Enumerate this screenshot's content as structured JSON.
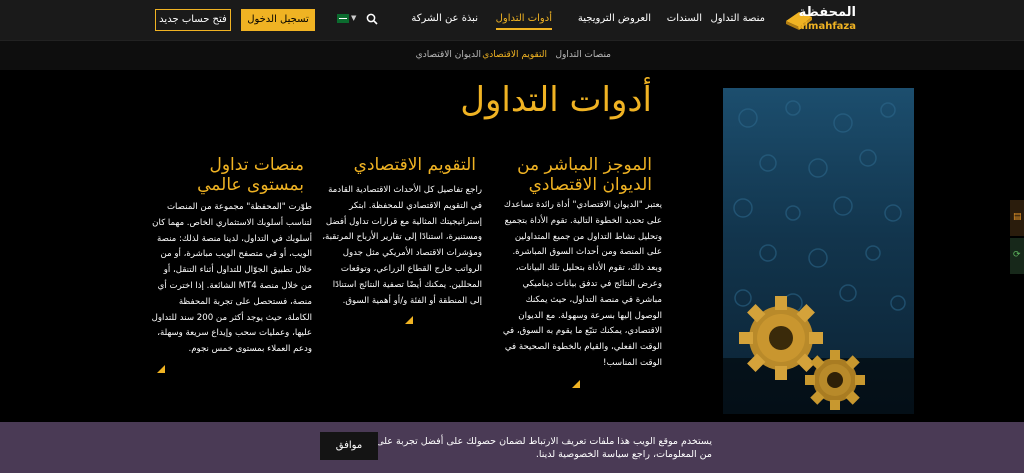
{
  "header": {
    "logo_ar": "المحفظة",
    "logo_en": "almahfaza",
    "nav": [
      {
        "label": "منصة التداول",
        "active": false
      },
      {
        "label": "السندات",
        "active": false
      },
      {
        "label": "العروض الترويجية",
        "active": false
      },
      {
        "label": "أدوات التداول",
        "active": true
      },
      {
        "label": "نبذة عن الشركة",
        "active": false
      }
    ],
    "language_flag": "saudi-flag-icon",
    "login_label": "تسجيل الدخول",
    "open_account_label": "فتح حساب جديد"
  },
  "subnav": [
    {
      "label": "منصات التداول",
      "active": false
    },
    {
      "label": "التقويم الاقتصادي",
      "active": true
    },
    {
      "label": "الديوان الاقتصادي",
      "active": false
    }
  ],
  "main": {
    "title": "أدوات التداول",
    "columns": [
      {
        "title": "الموجز المباشر من الديوان الاقتصادي",
        "text": "يعتبر \"الديوان الاقتصادي\" أداة رائدة تساعدك على تحديد الخطوة التالية. تقوم الأداة بتجميع وتحليل نشاط التداول من جميع المتداولين على المنصة ومن أحداث السوق المباشرة. وبعد ذلك، تقوم الأداة بتحليل تلك البيانات، وعرض النتائج في تدفق بيانات ديناميكي مباشرة في منصة التداول، حيث يمكنك الوصول إليها بسرعة وسهولة. مع الديوان الاقتصادي، يمكنك تتبّع ما يقوم به السوق، في الوقت الفعلي، والقيام بالخطوة الصحيحة في الوقت المناسب!"
      },
      {
        "title": "التقويم الاقتصادي",
        "text": "راجع تفاصيل كل الأحداث الاقتصادية القادمة في التقويم الاقتصادي للمحفظة. ابتكر إستراتيجيتك المثالية مع قرارات تداول أفضل ومستنيرة، استنادًا إلى تقارير الأرباح المرتقبة، ومؤشرات الاقتصاد الأمريكي مثل جدول الرواتب خارج القطاع الزراعي، وتوقعات المحللين. يمكنك أيضًا تصفية النتائج استنادًا إلى المنطقة أو الفئة و/أو أهمية السوق."
      },
      {
        "title": "منصات تداول بمستوى عالمي",
        "text": "طوّرت \"المحفظة\" مجموعة من المنصات لتناسب أسلوبك الاستثماري الخاص. مهما كان أسلوبك في التداول، لدينا منصة لذلك: منصة الويب، أو في متصفح الويب مباشرة، أو من خلال تطبيق الجوّال للتداول أثناء التنقل، أو من خلال منصة MT4 الشائعة. إذا اخترت أي منصة، فستحصل على تجربة المحفظة الكاملة، حيث يوجد أكثر من 200 سند للتداول عليها، وعمليات سحب وإيداع سريعة وسهلة، ودعم العملاء بمستوى خمس نجوم."
      }
    ]
  },
  "cookie": {
    "text": "يستخدم موقع الويب هذا ملفات تعريف الارتباط لضمان حصولك على أفضل تجربة على موقعنا. لمزيد من المعلومات، راجع سياسة الخصوصية لدينا.",
    "accept_label": "موافق"
  },
  "colors": {
    "accent": "#f0b323",
    "topbar": "#1a1a1a",
    "cookie_bar": "#4a3a55"
  }
}
